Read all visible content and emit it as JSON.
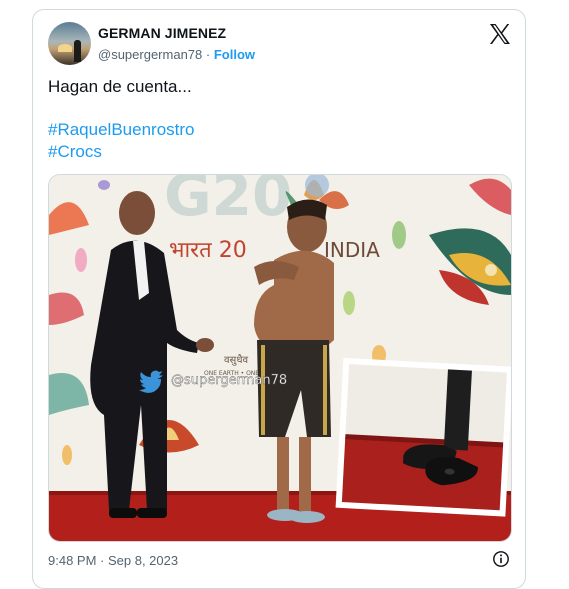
{
  "author": {
    "name": "GERMAN JIMENEZ",
    "handle": "@supergerman78",
    "separator": "·",
    "follow_label": "Follow"
  },
  "tweet": {
    "text": "Hagan de cuenta...",
    "hashtags": [
      "#RaquelBuenrostro",
      "#Crocs"
    ]
  },
  "media": {
    "backdrop_text": "G20",
    "backdrop_line2": "भारत 20",
    "backdrop_line3": "INDIA",
    "sub_logo": "वसुधैव",
    "sub_logo_line2": "ONE EARTH • ONE",
    "watermark": "@supergerman78"
  },
  "footer": {
    "timestamp": "9:48 PM · Sep 8, 2023"
  },
  "icons": {
    "platform": "x-logo-icon",
    "info": "info-icon",
    "watermark": "twitter-bird-icon"
  },
  "colors": {
    "accent": "#1d9bf0",
    "text": "#0f1419",
    "secondary": "#536471",
    "border": "#cfd9de"
  }
}
